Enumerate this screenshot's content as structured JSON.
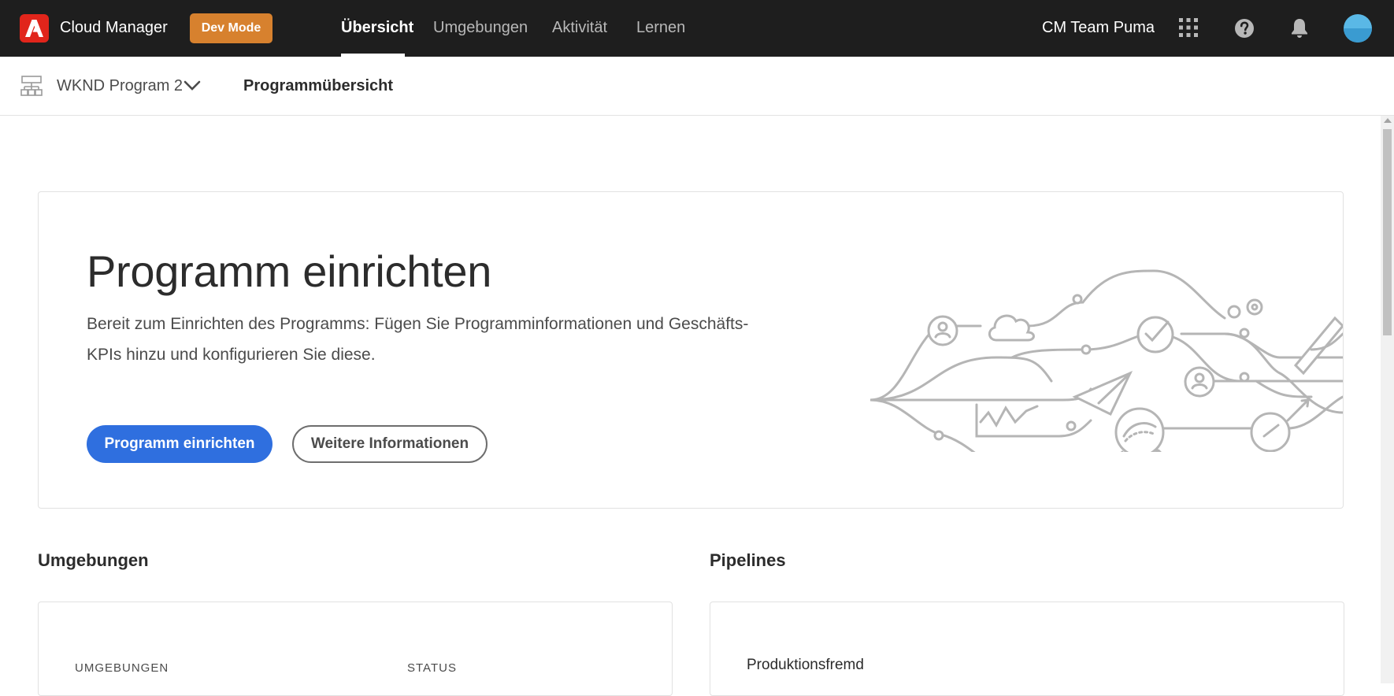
{
  "header": {
    "app_title": "Cloud Manager",
    "dev_mode_label": "Dev Mode",
    "nav": [
      {
        "label": "Übersicht",
        "active": true
      },
      {
        "label": "Umgebungen",
        "active": false
      },
      {
        "label": "Aktivität",
        "active": false
      },
      {
        "label": "Lernen",
        "active": false
      }
    ],
    "org_name": "CM Team Puma",
    "icons": [
      "apps-grid-icon",
      "help-icon",
      "notifications-bell-icon",
      "user-avatar"
    ]
  },
  "subheader": {
    "program_name": "WKND Program 2",
    "page_title": "Programmübersicht"
  },
  "hero": {
    "title": "Programm einrichten",
    "description_line1": "Bereit zum Einrichten des Programms: Fügen Sie Programminformationen und Geschäfts-",
    "description_line2": "KPIs hinzu und konfigurieren Sie diese.",
    "primary_button": "Programm einrichten",
    "secondary_button": "Weitere Informationen"
  },
  "environments": {
    "title": "Umgebungen",
    "columns": [
      "UMGEBUNGEN",
      "STATUS"
    ]
  },
  "pipelines": {
    "title": "Pipelines",
    "items": [
      "Produktionsfremd"
    ]
  },
  "colors": {
    "topbar": "#1e1e1e",
    "adobe_red": "#e1251b",
    "dev_mode": "#d7812e",
    "primary_blue": "#2f6fdf"
  }
}
